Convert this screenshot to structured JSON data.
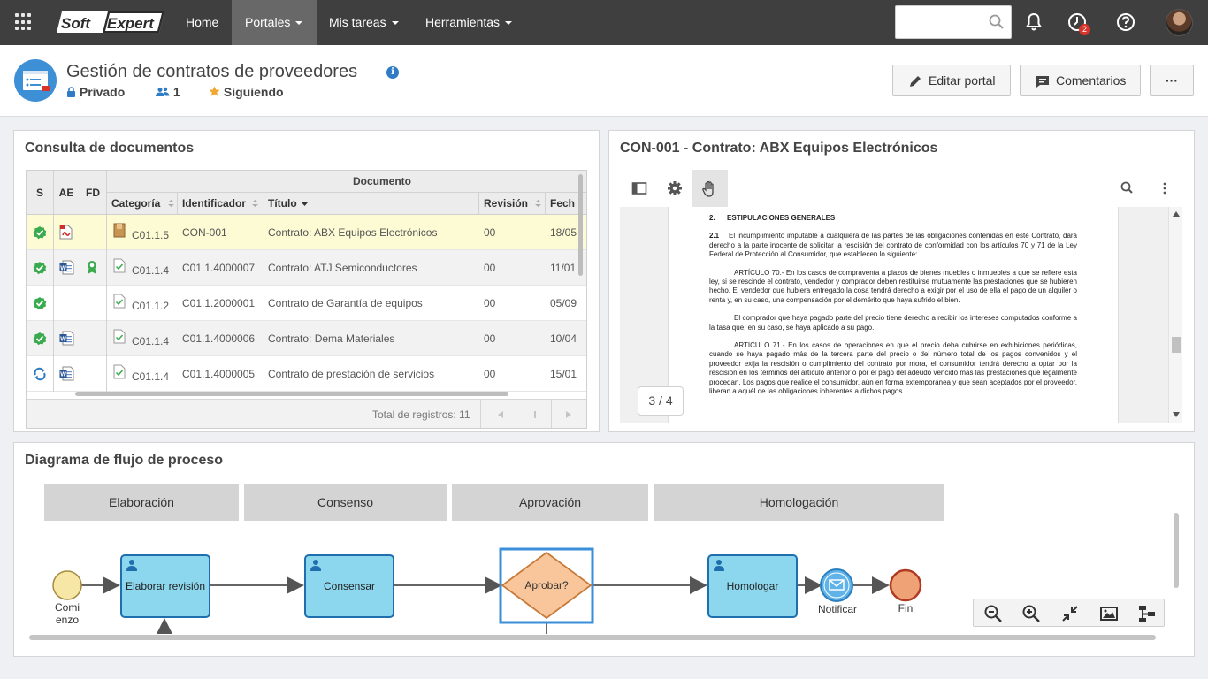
{
  "nav": {
    "brand": "SoftExpert",
    "brand_soft": "Soft",
    "brand_expert": "Expert",
    "items": [
      {
        "label": "Home"
      },
      {
        "label": "Portales"
      },
      {
        "label": "Mis tareas"
      },
      {
        "label": "Herramientas"
      }
    ],
    "search_placeholder": "",
    "notification_count": "2"
  },
  "header": {
    "title": "Gestión de contratos de proveedores",
    "privacy": "Privado",
    "members": "1",
    "following": "Siguiendo",
    "edit_button": "Editar portal",
    "comments_button": "Comentarios",
    "more_button": "···"
  },
  "documents": {
    "title": "Consulta de documentos",
    "group_header": "Documento",
    "columns": {
      "s": "S",
      "ae": "AE",
      "fd": "FD",
      "categoria": "Categoría",
      "identificador": "Identificador",
      "titulo": "Título",
      "revision": "Revisión",
      "fecha": "Fech"
    },
    "rows": [
      {
        "status": "approved",
        "ae": "pdf",
        "fd": "",
        "categoria": "C01.1.5",
        "identificador": "CON-001",
        "titulo": "Contrato: ABX Equipos Electrónicos",
        "revision": "00",
        "fecha": "18/05"
      },
      {
        "status": "approved",
        "ae": "word",
        "fd": "award",
        "categoria": "C01.1.4",
        "identificador": "C01.1.4000007",
        "titulo": "Contrato: ATJ Semiconductores",
        "revision": "00",
        "fecha": "11/01"
      },
      {
        "status": "approved",
        "ae": "",
        "fd": "",
        "categoria": "C01.1.2",
        "identificador": "C01.1.2000001",
        "titulo": "Contrato de Garantía de equipos",
        "revision": "00",
        "fecha": "05/09"
      },
      {
        "status": "approved",
        "ae": "word",
        "fd": "",
        "categoria": "C01.1.4",
        "identificador": "C01.1.4000006",
        "titulo": "Contrato: Dema Materiales",
        "revision": "00",
        "fecha": "10/04"
      },
      {
        "status": "in-progress",
        "ae": "word",
        "fd": "",
        "categoria": "C01.1.4",
        "identificador": "C01.1.4000005",
        "titulo": "Contrato de prestación de servicios",
        "revision": "00",
        "fecha": "15/01"
      }
    ],
    "total_label": "Total de registros: 11"
  },
  "viewer": {
    "title": "CON-001 - Contrato: ABX Equipos Electrónicos",
    "page_indicator": "3 / 4",
    "section_number": "2.",
    "section_heading": "ESTIPULACIONES GENERALES",
    "clause_number": "2.1",
    "clause_text": "El incumplimiento imputable a cualquiera de las partes de las obligaciones contenidas en este Contrato, dará derecho a la parte inocente de solicitar la rescisión del contrato de conformidad con los artículos 70 y 71 de la Ley Federal de Protección al Consumidor, que establecen lo siguiente:",
    "paragraphs": [
      "ARTÍCULO 70.- En los casos de compraventa a plazos de bienes muebles o inmuebles a que se refiere esta ley, si se rescinde el contrato, vendedor y comprador deben restituirse mutuamente las prestaciones que se hubieren hecho. El vendedor que hubiera entregado la cosa tendrá derecho a exigir por el uso de ella el pago de un alquiler o renta y, en su caso, una compensación por el demérito que haya sufrido el bien.",
      "El comprador que haya pagado parte del precio tiene derecho a recibir los intereses computados conforme a la tasa que, en su caso, se haya aplicado a su pago.",
      "ARTICULO 71.- En los casos de operaciones en que el precio deba cubrirse en exhibiciones periódicas, cuando se haya pagado más de la tercera parte del precio o del número total de los pagos convenidos y el proveedor exija la rescisión o cumplimiento del contrato por mora, el consumidor tendrá derecho a optar por la rescisión en los términos del artículo anterior o por el pago del adeudo vencido más las prestaciones que legalmente procedan. Los pagos que realice el consumidor, aún en forma extemporánea y que sean aceptados por el proveedor, liberan a aquél de las obligaciones inherentes a dichos pagos."
    ]
  },
  "flow": {
    "title": "Diagrama de flujo de proceso",
    "lanes": [
      "Elaboración",
      "Consenso",
      "Aprovación",
      "Homologación"
    ],
    "start_label_line1": "Comi",
    "start_label_line2": "enzo",
    "tasks": [
      "Elaborar revisión",
      "Consensar",
      "Homologar"
    ],
    "gateway": "Aprobar?",
    "notify_label": "Notificar",
    "end_label": "Fin"
  }
}
